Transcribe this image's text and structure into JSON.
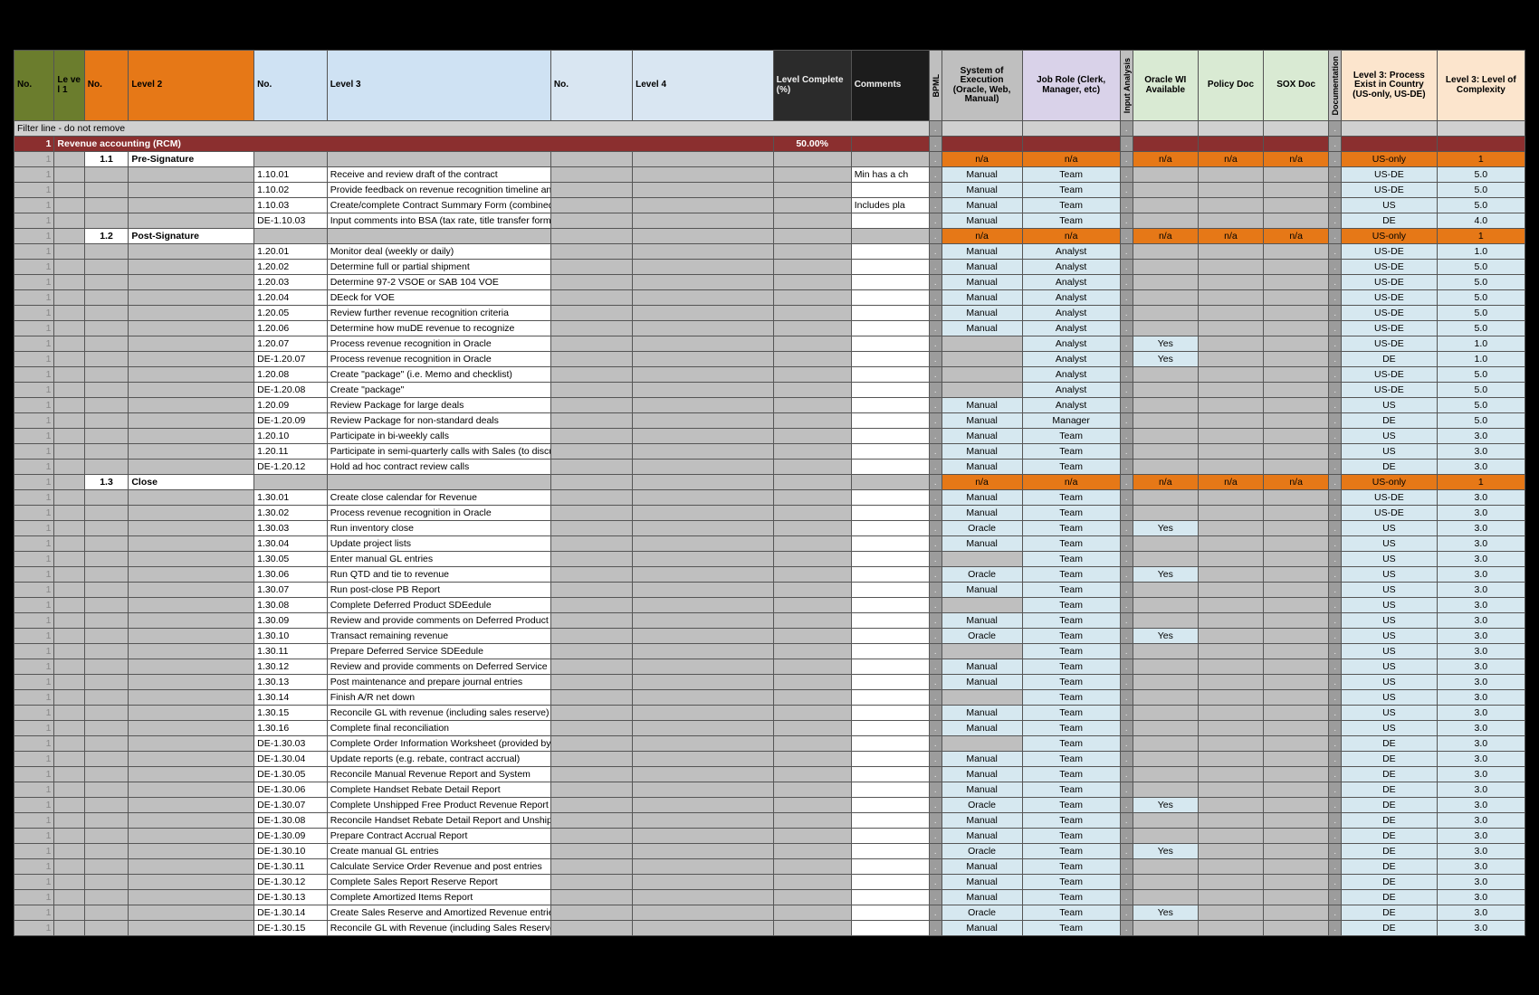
{
  "headers": {
    "c0": "No.",
    "c1": "Le\nve\nl 1",
    "c2": "No.",
    "c3": "Level 2",
    "c4": "No.",
    "c5": "Level 3",
    "c6": "No.",
    "c7": "Level 4",
    "c8": "Level\nComplete (%)",
    "c9": "Comments",
    "c10": "BPML",
    "c11": "System of Execution (Oracle, Web, Manual)",
    "c12": "Job Role (Clerk, Manager, etc)",
    "c13": "Input Analysis",
    "c14": "Oracle WI Available",
    "c15": "Policy Doc",
    "c16": "SOX Doc",
    "c17": "Documentation",
    "c18": "Level 3: Process Exist in Country (US-only, US-DE)",
    "c19": "Level 3: Level of Complexity"
  },
  "filter_note": "Filter line - do not remove",
  "section": {
    "no": "1",
    "title": "Revenue accounting (RCM)",
    "pct": "50.00%"
  },
  "rows": [
    {
      "k": "l2",
      "l2no": "1.1",
      "l2": "Pre-Signature",
      "na": true,
      "country": "US-only",
      "cx": "1"
    },
    {
      "k": "l3",
      "no": "1.10.01",
      "t": "Receive and review draft of the contract",
      "c9": "Min has a ch",
      "sys": "Manual",
      "role": "Team",
      "country": "US-DE",
      "cx": "5.0"
    },
    {
      "k": "l3",
      "no": "1.10.02",
      "t": "Provide feedback on revenue recognition timeline and guidance",
      "sys": "Manual",
      "role": "Team",
      "country": "US-DE",
      "cx": "5.0"
    },
    {
      "k": "l3",
      "no": "1.10.03",
      "t": "Create/complete Contract Summary Form (combined w/ above)",
      "c9": "Includes pla",
      "sys": "Manual",
      "role": "Team",
      "country": "US",
      "cx": "5.0"
    },
    {
      "k": "l3",
      "no": "DE-1.10.03",
      "t": "Input comments into BSA (tax rate, title transfer form, rev rec rules, order type)",
      "sys": "Manual",
      "role": "Team",
      "country": "DE",
      "cx": "4.0"
    },
    {
      "k": "l2",
      "l2no": "1.2",
      "l2": "Post-Signature",
      "na": true,
      "country": "US-only",
      "cx": "1"
    },
    {
      "k": "l3",
      "no": "1.20.01",
      "t": "Monitor deal (weekly or daily)",
      "sys": "Manual",
      "role": "Analyst",
      "country": "US-DE",
      "cx": "1.0"
    },
    {
      "k": "l3",
      "no": "1.20.02",
      "t": "Determine full or partial shipment",
      "sys": "Manual",
      "role": "Analyst",
      "country": "US-DE",
      "cx": "5.0"
    },
    {
      "k": "l3",
      "no": "1.20.03",
      "t": "Determine 97-2 VSOE or SAB 104 VOE",
      "sys": "Manual",
      "role": "Analyst",
      "country": "US-DE",
      "cx": "5.0"
    },
    {
      "k": "l3",
      "no": "1.20.04",
      "t": "DEeck for VOE",
      "sys": "Manual",
      "role": "Analyst",
      "country": "US-DE",
      "cx": "5.0"
    },
    {
      "k": "l3",
      "no": "1.20.05",
      "t": "Review further revenue recognition criteria",
      "sys": "Manual",
      "role": "Analyst",
      "country": "US-DE",
      "cx": "5.0"
    },
    {
      "k": "l3",
      "no": "1.20.06",
      "t": "Determine how muDE revenue to recognize",
      "sys": "Manual",
      "role": "Analyst",
      "country": "US-DE",
      "cx": "5.0"
    },
    {
      "k": "l3",
      "no": "1.20.07",
      "t": "Process revenue recognition in Oracle",
      "role": "Analyst",
      "wi": "Yes",
      "country": "US-DE",
      "cx": "1.0"
    },
    {
      "k": "l3",
      "no": "DE-1.20.07",
      "t": "Process revenue recognition in Oracle",
      "role": "Analyst",
      "wi": "Yes",
      "country": "DE",
      "cx": "1.0"
    },
    {
      "k": "l3",
      "no": "1.20.08",
      "t": "Create \"package\" (i.e. Memo and checklist)",
      "role": "Analyst",
      "country": "US-DE",
      "cx": "5.0"
    },
    {
      "k": "l3",
      "no": "DE-1.20.08",
      "t": "Create \"package\"",
      "role": "Analyst",
      "country": "US-DE",
      "cx": "5.0"
    },
    {
      "k": "l3",
      "no": "1.20.09",
      "t": "Review Package for large deals",
      "sys": "Manual",
      "role": "Analyst",
      "country": "US",
      "cx": "5.0"
    },
    {
      "k": "l3",
      "no": "DE-1.20.09",
      "t": "Review Package for non-standard deals",
      "sys": "Manual",
      "role": "Manager",
      "country": "DE",
      "cx": "5.0"
    },
    {
      "k": "l3",
      "no": "1.20.10",
      "t": "Participate in bi-weekly calls",
      "sys": "Manual",
      "role": "Team",
      "country": "US",
      "cx": "3.0"
    },
    {
      "k": "l3",
      "no": "1.20.11",
      "t": "Participate in semi-quarterly calls with Sales (to discuss large deals)",
      "sys": "Manual",
      "role": "Team",
      "country": "US",
      "cx": "3.0"
    },
    {
      "k": "l3",
      "no": "DE-1.20.12",
      "t": "Hold ad hoc contract review calls",
      "sys": "Manual",
      "role": "Team",
      "country": "DE",
      "cx": "3.0"
    },
    {
      "k": "l2",
      "l2no": "1.3",
      "l2": "Close",
      "na": true,
      "country": "US-only",
      "cx": "1"
    },
    {
      "k": "l3",
      "no": "1.30.01",
      "t": "Create close calendar for Revenue",
      "sys": "Manual",
      "role": "Team",
      "country": "US-DE",
      "cx": "3.0"
    },
    {
      "k": "l3",
      "no": "1.30.02",
      "t": "Process revenue recognition in Oracle",
      "sys": "Manual",
      "role": "Team",
      "country": "US-DE",
      "cx": "3.0"
    },
    {
      "k": "l3",
      "no": "1.30.03",
      "t": "Run inventory close",
      "sys": "Oracle",
      "role": "Team",
      "wi": "Yes",
      "country": "US",
      "cx": "3.0"
    },
    {
      "k": "l3",
      "no": "1.30.04",
      "t": "Update project lists",
      "sys": "Manual",
      "role": "Team",
      "country": "US",
      "cx": "3.0"
    },
    {
      "k": "l3",
      "no": "1.30.05",
      "t": "Enter manual GL entries",
      "role": "Team",
      "country": "US",
      "cx": "3.0"
    },
    {
      "k": "l3",
      "no": "1.30.06",
      "t": "Run QTD and tie to revenue",
      "sys": "Oracle",
      "role": "Team",
      "wi": "Yes",
      "country": "US",
      "cx": "3.0"
    },
    {
      "k": "l3",
      "no": "1.30.07",
      "t": "Run post-close PB Report",
      "sys": "Manual",
      "role": "Team",
      "country": "US",
      "cx": "3.0"
    },
    {
      "k": "l3",
      "no": "1.30.08",
      "t": "Complete Deferred Product SDEedule",
      "role": "Team",
      "country": "US",
      "cx": "3.0"
    },
    {
      "k": "l3",
      "no": "1.30.09",
      "t": "Review and provide comments on Deferred Product SDEedule",
      "sys": "Manual",
      "role": "Team",
      "country": "US",
      "cx": "3.0"
    },
    {
      "k": "l3",
      "no": "1.30.10",
      "t": "Transact remaining revenue",
      "sys": "Oracle",
      "role": "Team",
      "wi": "Yes",
      "country": "US",
      "cx": "3.0"
    },
    {
      "k": "l3",
      "no": "1.30.11",
      "t": "Prepare Deferred Service SDEedule",
      "role": "Team",
      "country": "US",
      "cx": "3.0"
    },
    {
      "k": "l3",
      "no": "1.30.12",
      "t": "Review and provide comments on Deferred Service SDEedule",
      "sys": "Manual",
      "role": "Team",
      "country": "US",
      "cx": "3.0"
    },
    {
      "k": "l3",
      "no": "1.30.13",
      "t": "Post maintenance and prepare journal entries",
      "sys": "Manual",
      "role": "Team",
      "country": "US",
      "cx": "3.0"
    },
    {
      "k": "l3",
      "no": "1.30.14",
      "t": "Finish A/R net down",
      "role": "Team",
      "country": "US",
      "cx": "3.0"
    },
    {
      "k": "l3",
      "no": "1.30.15",
      "t": "Reconcile GL with revenue (including sales reserve)",
      "sys": "Manual",
      "role": "Team",
      "country": "US",
      "cx": "3.0"
    },
    {
      "k": "l3",
      "no": "1.30.16",
      "t": "Complete final reconciliation",
      "sys": "Manual",
      "role": "Team",
      "country": "US",
      "cx": "3.0"
    },
    {
      "k": "l3",
      "no": "DE-1.30.03",
      "t": "Complete Order Information Worksheet (provided by Sales Ops)",
      "role": "Team",
      "country": "DE",
      "cx": "3.0"
    },
    {
      "k": "l3",
      "no": "DE-1.30.04",
      "t": "Update reports (e.g. rebate, contract accrual)",
      "sys": "Manual",
      "role": "Team",
      "country": "DE",
      "cx": "3.0"
    },
    {
      "k": "l3",
      "no": "DE-1.30.05",
      "t": "Reconcile Manual Revenue Report and System",
      "sys": "Manual",
      "role": "Team",
      "country": "DE",
      "cx": "3.0"
    },
    {
      "k": "l3",
      "no": "DE-1.30.06",
      "t": "Complete Handset Rebate Detail Report",
      "sys": "Manual",
      "role": "Team",
      "country": "DE",
      "cx": "3.0"
    },
    {
      "k": "l3",
      "no": "DE-1.30.07",
      "t": "Complete Unshipped Free Product Revenue Report",
      "sys": "Oracle",
      "role": "Team",
      "wi": "Yes",
      "country": "DE",
      "cx": "3.0"
    },
    {
      "k": "l3",
      "no": "DE-1.30.08",
      "t": "Reconcile Handset Rebate Detail Report and Unshipped Free Product Revenue Report)",
      "sys": "Manual",
      "role": "Team",
      "country": "DE",
      "cx": "3.0"
    },
    {
      "k": "l3",
      "no": "DE-1.30.09",
      "t": "Prepare Contract Accrual Report",
      "sys": "Manual",
      "role": "Team",
      "country": "DE",
      "cx": "3.0"
    },
    {
      "k": "l3",
      "no": "DE-1.30.10",
      "t": "Create manual GL entries",
      "sys": "Oracle",
      "role": "Team",
      "wi": "Yes",
      "country": "DE",
      "cx": "3.0"
    },
    {
      "k": "l3",
      "no": "DE-1.30.11",
      "t": "Calculate Service Order Revenue and post entries",
      "sys": "Manual",
      "role": "Team",
      "country": "DE",
      "cx": "3.0"
    },
    {
      "k": "l3",
      "no": "DE-1.30.12",
      "t": "Complete Sales Report Reserve Report",
      "sys": "Manual",
      "role": "Team",
      "country": "DE",
      "cx": "3.0"
    },
    {
      "k": "l3",
      "no": "DE-1.30.13",
      "t": "Complete Amortized Items Report",
      "sys": "Manual",
      "role": "Team",
      "country": "DE",
      "cx": "3.0"
    },
    {
      "k": "l3",
      "no": "DE-1.30.14",
      "t": "Create Sales Reserve and Amortized Revenue entries",
      "sys": "Oracle",
      "role": "Team",
      "wi": "Yes",
      "country": "DE",
      "cx": "3.0"
    },
    {
      "k": "l3",
      "no": "DE-1.30.15",
      "t": "Reconcile GL with Revenue (including Sales Reserve)",
      "sys": "Manual",
      "role": "Team",
      "country": "DE",
      "cx": "3.0"
    }
  ],
  "dot": ".",
  "na": "n/a",
  "one": "1"
}
